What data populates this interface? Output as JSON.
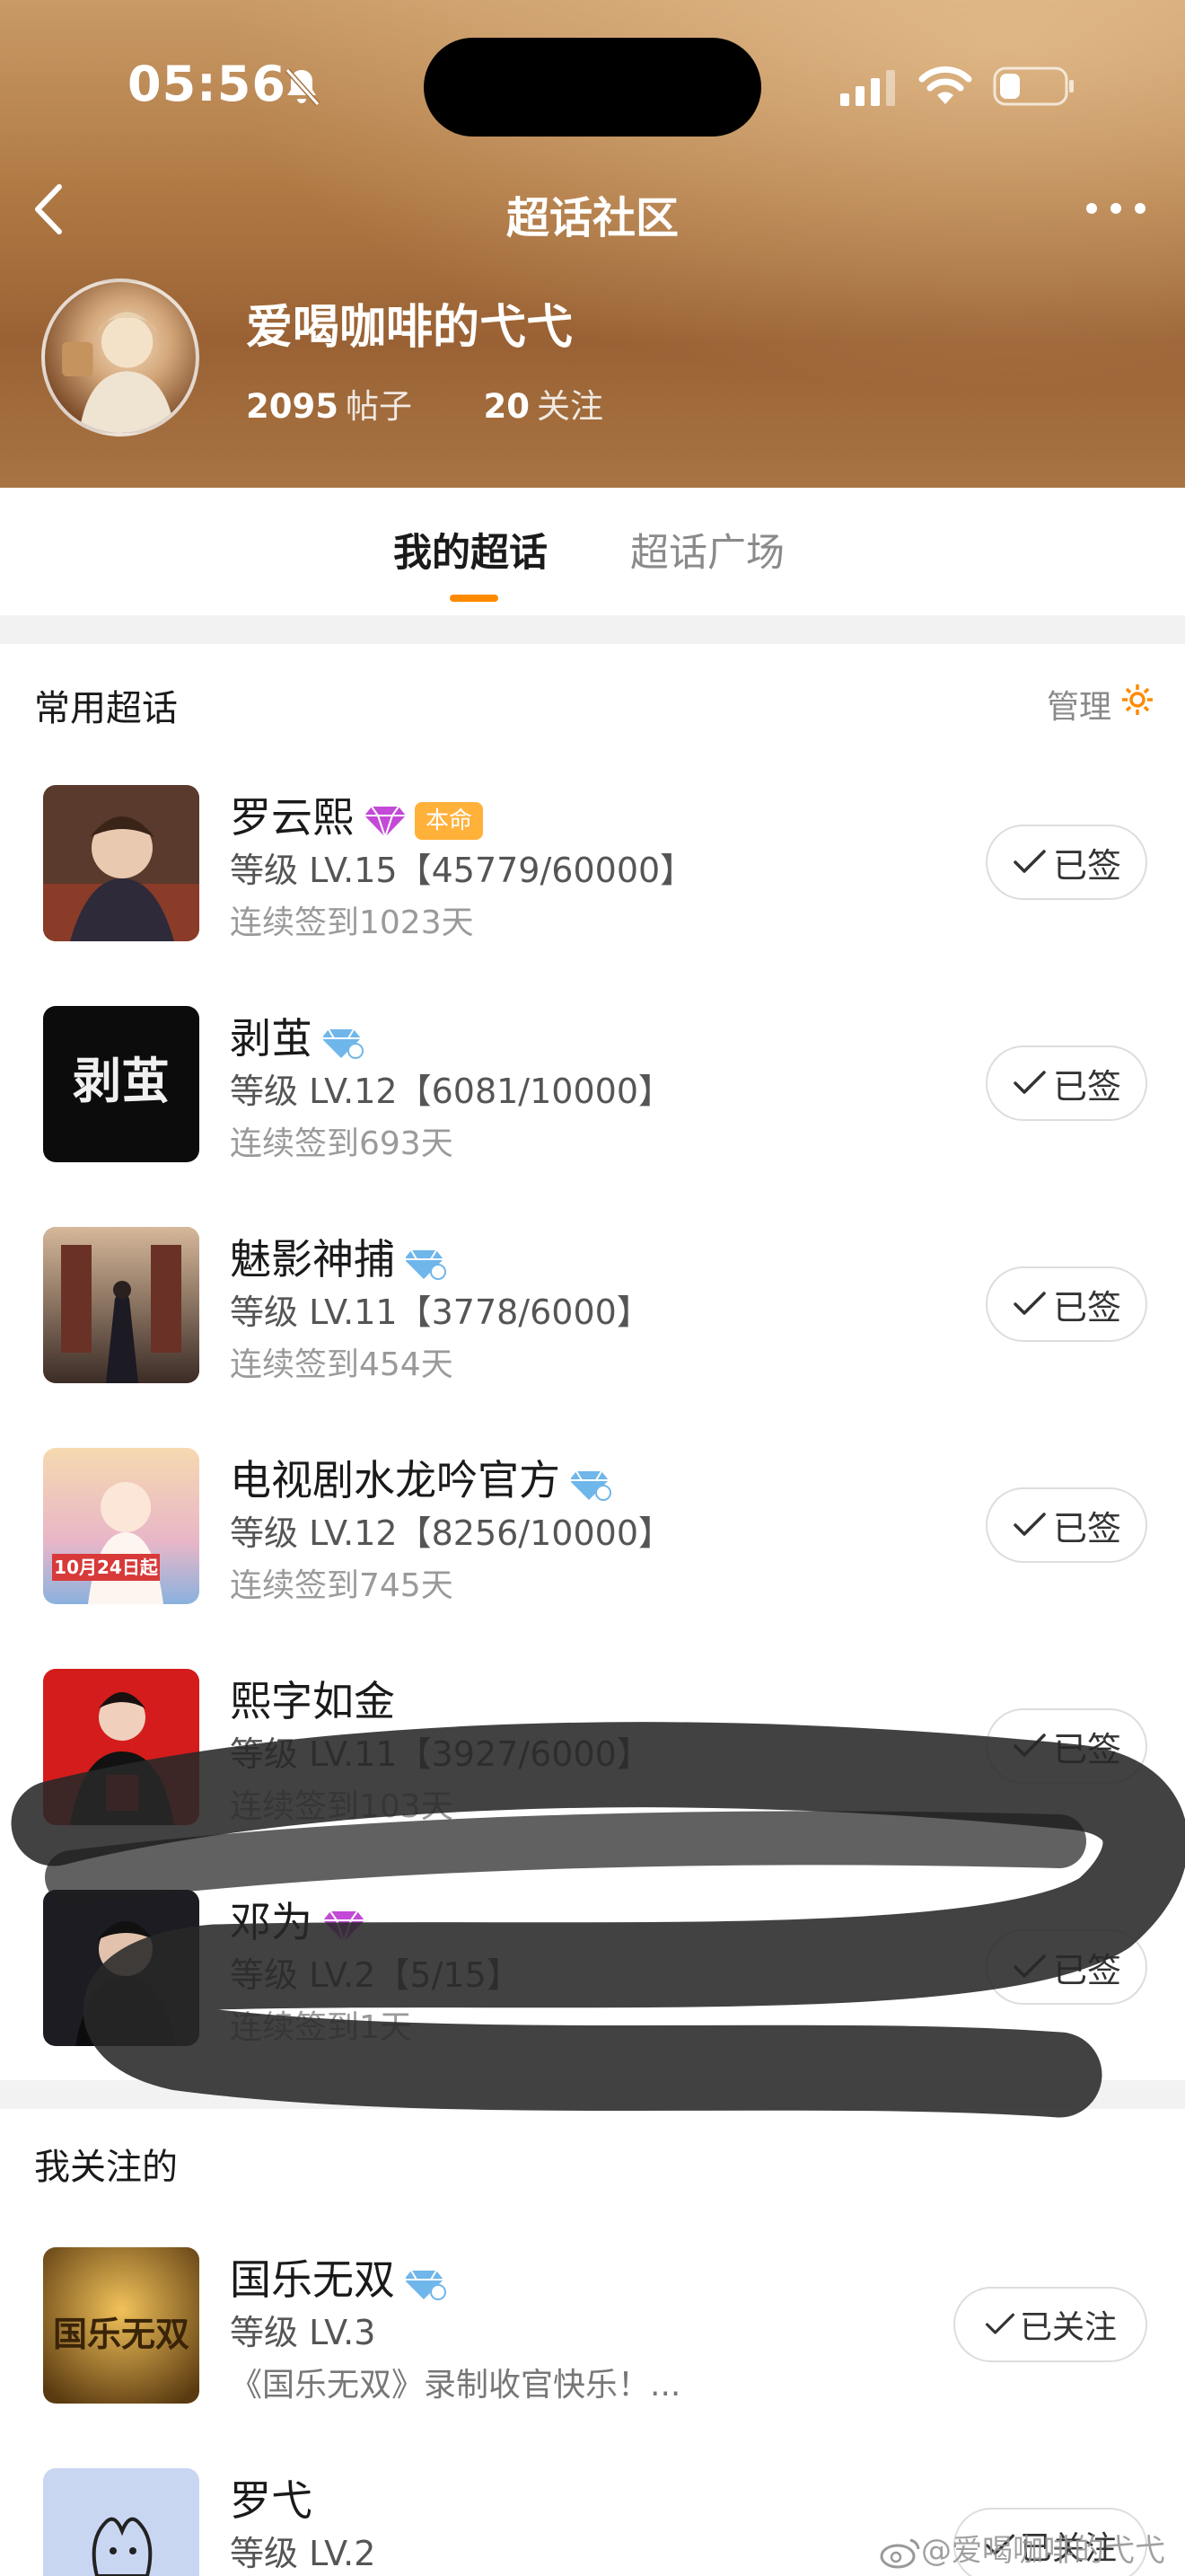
{
  "status_bar": {
    "time": "05:56"
  },
  "nav": {
    "title": "超话社区"
  },
  "profile": {
    "name": "爱喝咖啡的弋弋",
    "posts_count": "2095",
    "posts_label": "帖子",
    "following_count": "20",
    "following_label": "关注"
  },
  "tabs": [
    {
      "label": "我的超话",
      "active": true
    },
    {
      "label": "超话广场",
      "active": false
    }
  ],
  "frequent": {
    "title": "常用超话",
    "manage_label": "管理",
    "items": [
      {
        "name": "罗云熙",
        "badge": "purple-diamond",
        "tag": "本命",
        "level": "等级 LV.15【45779/60000】",
        "streak": "连续签到1023天",
        "button": "已签"
      },
      {
        "name": "剥茧",
        "badge": "blue-diamond",
        "level": "等级 LV.12【6081/10000】",
        "streak": "连续签到693天",
        "button": "已签"
      },
      {
        "name": "魅影神捕",
        "badge": "blue-diamond",
        "level": "等级 LV.11【3778/6000】",
        "streak": "连续签到454天",
        "button": "已签"
      },
      {
        "name": "电视剧水龙吟官方",
        "badge": "blue-diamond",
        "level": "等级 LV.12【8256/10000】",
        "streak": "连续签到745天",
        "button": "已签"
      },
      {
        "name": "熙字如金",
        "level": "等级 LV.11【3927/6000】",
        "streak": "连续签到103天",
        "button": "已签"
      },
      {
        "name": "邓为",
        "badge": "purple-diamond",
        "level": "等级 LV.2【5/15】",
        "streak": "连续签到1天",
        "button": "已签"
      }
    ]
  },
  "following": {
    "title": "我关注的",
    "items": [
      {
        "name": "国乐无双",
        "badge": "blue-diamond",
        "level": "等级 LV.3",
        "desc": "《国乐无双》录制收官快乐！...",
        "button": "已关注"
      },
      {
        "name": "罗弋",
        "level": "等级 LV.2",
        "button": "已关注"
      }
    ]
  },
  "thumb_text": {
    "bojian": "剥茧",
    "shuilongyin_date": "10月24日起",
    "guoyue": "国乐无双"
  },
  "watermark": "@爱喝咖啡的弋弋",
  "colors": {
    "accent": "#ff8a00",
    "tag_bg": "#ffb13a",
    "header_gold": "#b07a45"
  }
}
